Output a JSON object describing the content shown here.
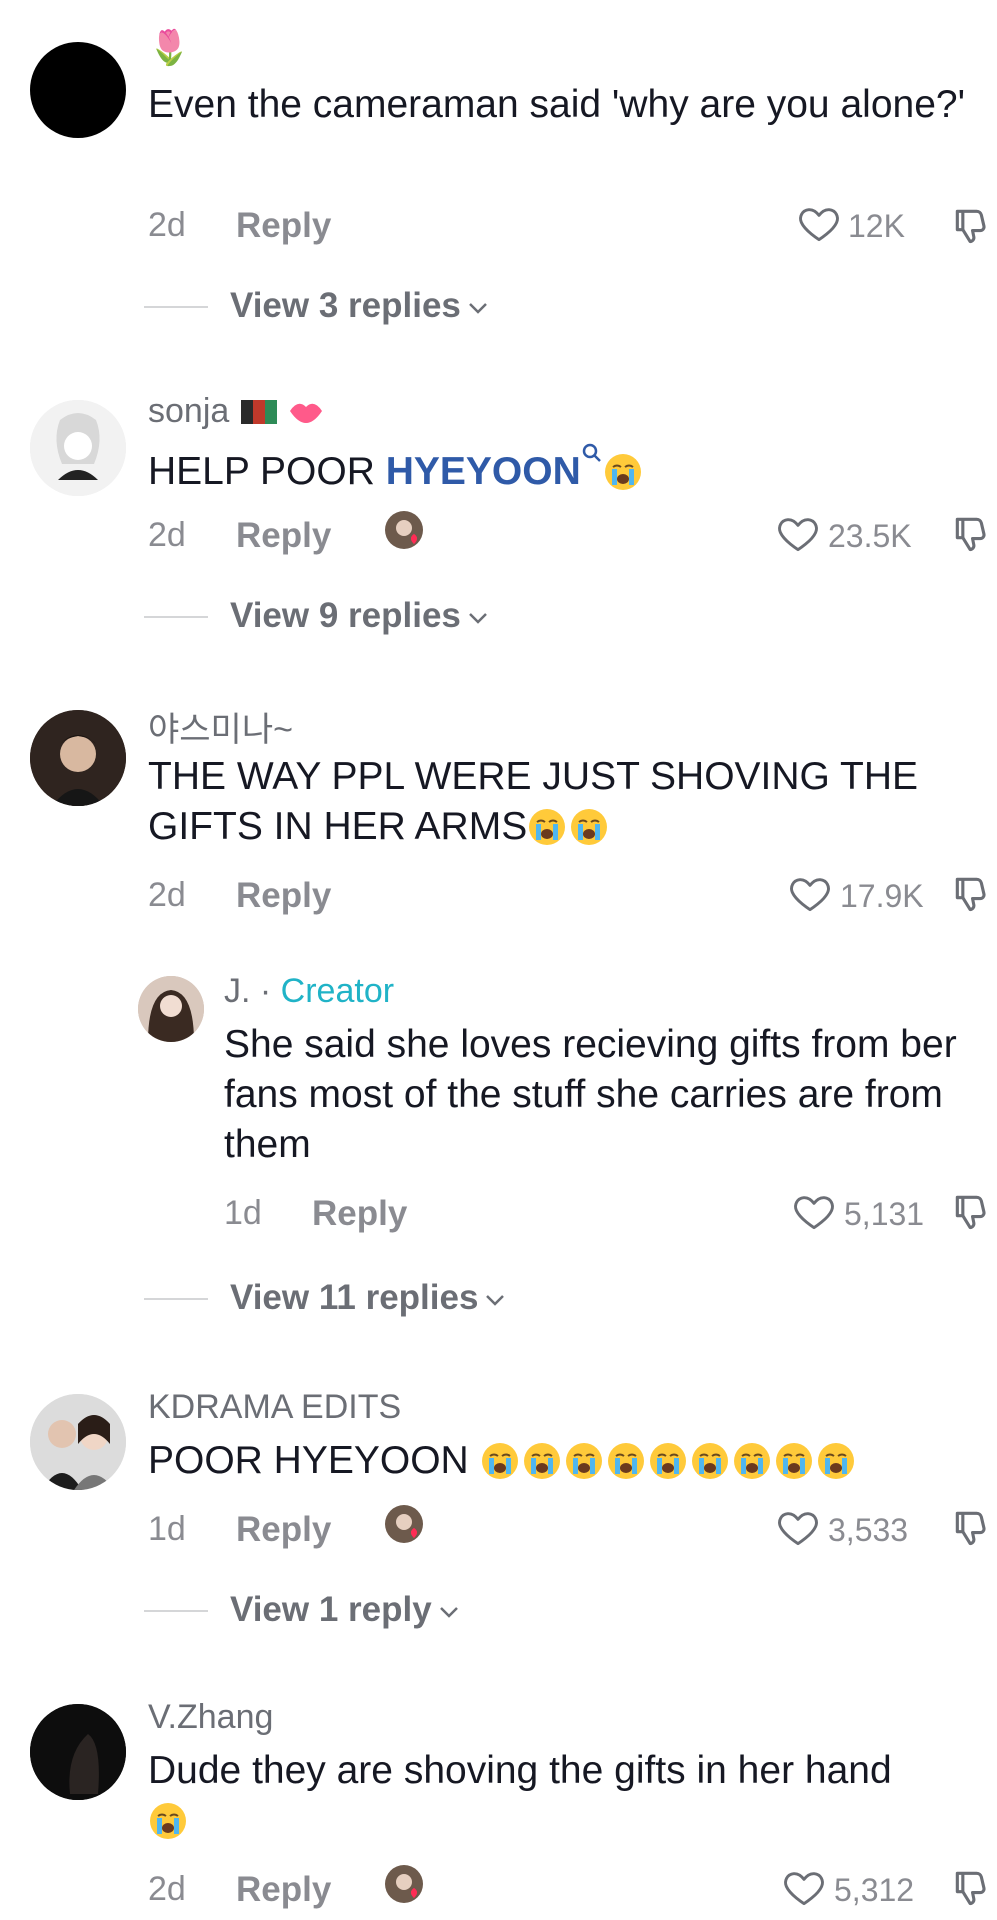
{
  "comments": [
    {
      "username": "🌷",
      "text": "Even the cameraman said 'why are you alone?'",
      "age": "2d",
      "reply_label": "Reply",
      "likes": "12K",
      "view_replies": "View 3 replies"
    },
    {
      "username": "sonja",
      "text_prefix": "HELP POOR ",
      "text_link": "HYEYOON",
      "age": "2d",
      "reply_label": "Reply",
      "likes": "23.5K",
      "view_replies": "View 9 replies"
    },
    {
      "username": "야스미나~",
      "text": "THE WAY PPL WERE JUST SHOVING THE GIFTS IN HER ARMS",
      "age": "2d",
      "reply_label": "Reply",
      "likes": "17.9K",
      "reply": {
        "username": "J.",
        "separator": " · ",
        "creator_label": "Creator",
        "text": "She said she loves recieving gifts from ber fans most of the stuff she carries are from them",
        "age": "1d",
        "reply_label": "Reply",
        "likes": "5,131"
      },
      "view_replies": "View 11 replies"
    },
    {
      "username": "KDRAMA EDITS",
      "text": "POOR HYEYOON",
      "age": "1d",
      "reply_label": "Reply",
      "likes": "3,533",
      "view_replies": "View 1 reply"
    },
    {
      "username": "V.Zhang",
      "text": "Dude they are shoving the gifts in her hand",
      "age": "2d",
      "reply_label": "Reply",
      "likes": "5,312"
    }
  ],
  "icons": {
    "heart": "heart-outline-icon",
    "dislike": "thumbs-down-icon",
    "chevron": "chevron-down-icon",
    "emoji": "loudly-crying-face-emoji"
  },
  "colors": {
    "link": "#2f5aa8",
    "creator": "#20b3c7",
    "meta": "#8a8b91"
  }
}
